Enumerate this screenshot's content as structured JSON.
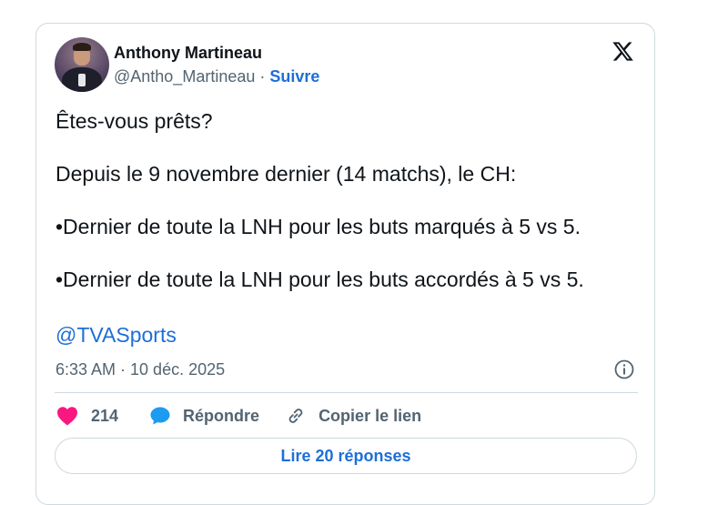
{
  "author": {
    "name": "Anthony Martineau",
    "handle": "@Antho_Martineau",
    "separator": " · ",
    "follow_label": "Suivre"
  },
  "tweet": {
    "paragraphs": [
      "Êtes-vous prêts?",
      "Depuis le 9 novembre dernier (14 matchs), le CH:",
      "•Dernier de toute la LNH pour les buts marqués à 5 vs 5.",
      "•Dernier de toute la LNH pour les buts accordés à 5 vs 5."
    ],
    "mention": "@TVASports",
    "timestamp": "6:33 AM · 10 déc. 2025"
  },
  "actions": {
    "like_count": "214",
    "reply_label": "Répondre",
    "copy_label": "Copier le lien"
  },
  "read_replies_label": "Lire 20 réponses",
  "icons": {
    "platform_logo": "x-logo-icon",
    "like": "heart-icon",
    "reply": "speech-bubble-icon",
    "copy": "link-icon",
    "info": "info-icon"
  },
  "colors": {
    "accent": "#1d6fd8",
    "like": "#f91880",
    "secondary_text": "#536471",
    "border": "#cfd9de"
  }
}
